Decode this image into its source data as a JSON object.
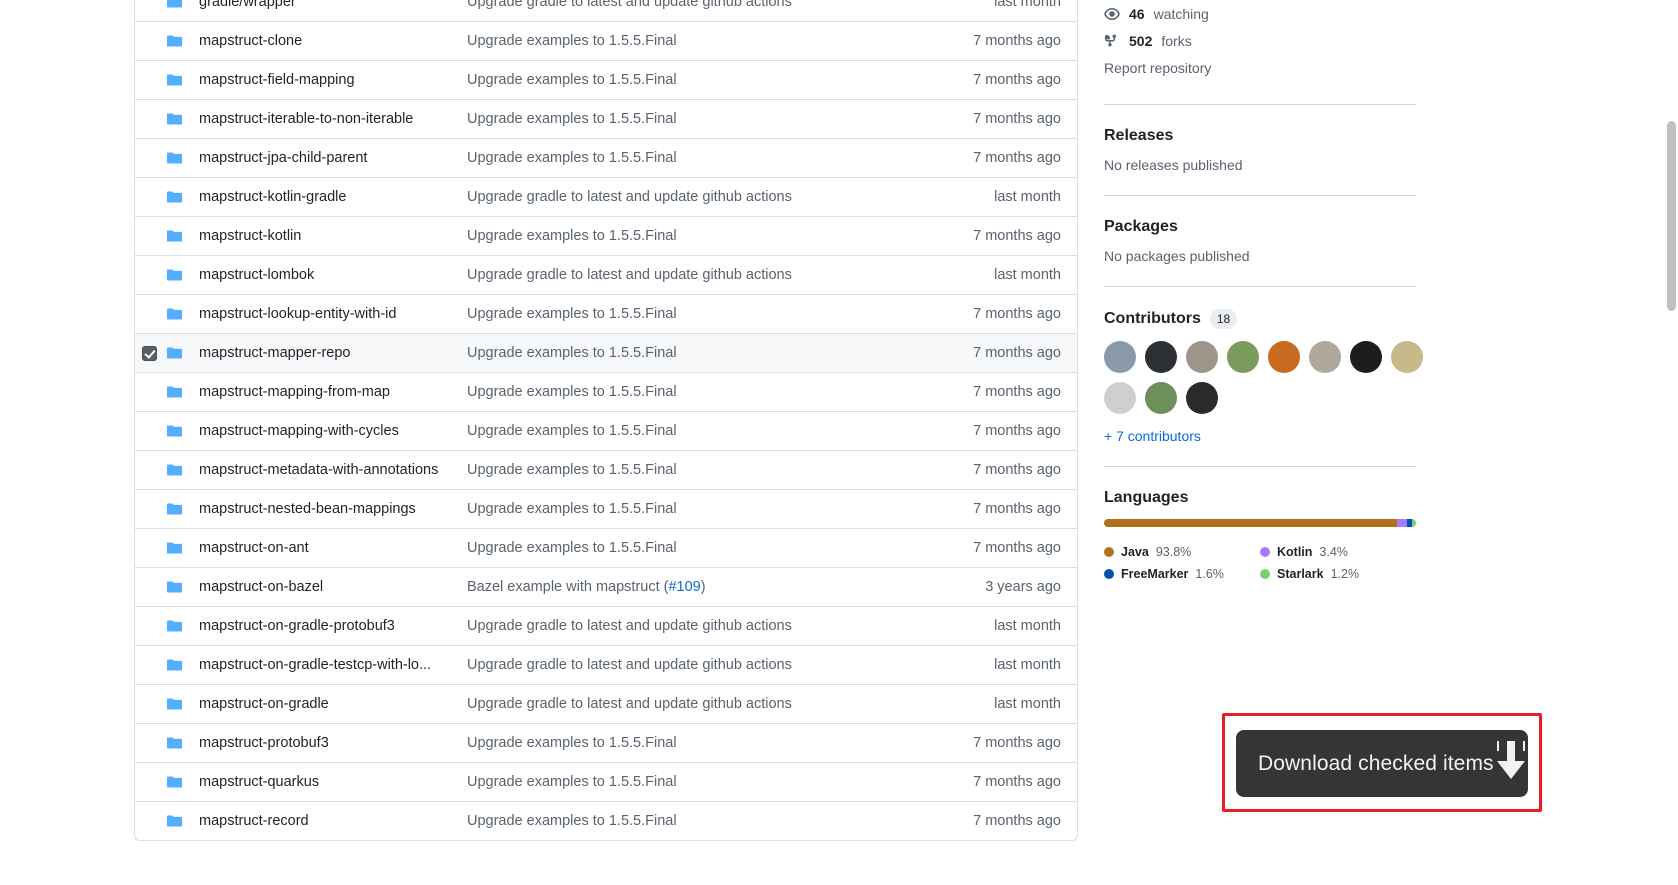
{
  "files": {
    "columns": [
      "checkbox",
      "icon",
      "name",
      "commit_message",
      "age"
    ],
    "rows": [
      {
        "checked": false,
        "icon": "folder-icon",
        "name": "gradle/wrapper",
        "message": "Upgrade gradle to latest and update github actions",
        "message_link": "",
        "age": "last month"
      },
      {
        "checked": false,
        "icon": "folder-icon",
        "name": "mapstruct-clone",
        "message": "Upgrade examples to 1.5.5.Final",
        "message_link": "",
        "age": "7 months ago"
      },
      {
        "checked": false,
        "icon": "folder-icon",
        "name": "mapstruct-field-mapping",
        "message": "Upgrade examples to 1.5.5.Final",
        "message_link": "",
        "age": "7 months ago"
      },
      {
        "checked": false,
        "icon": "folder-icon",
        "name": "mapstruct-iterable-to-non-iterable",
        "message": "Upgrade examples to 1.5.5.Final",
        "message_link": "",
        "age": "7 months ago"
      },
      {
        "checked": false,
        "icon": "folder-icon",
        "name": "mapstruct-jpa-child-parent",
        "message": "Upgrade examples to 1.5.5.Final",
        "message_link": "",
        "age": "7 months ago"
      },
      {
        "checked": false,
        "icon": "folder-icon",
        "name": "mapstruct-kotlin-gradle",
        "message": "Upgrade gradle to latest and update github actions",
        "message_link": "",
        "age": "last month"
      },
      {
        "checked": false,
        "icon": "folder-icon",
        "name": "mapstruct-kotlin",
        "message": "Upgrade examples to 1.5.5.Final",
        "message_link": "",
        "age": "7 months ago"
      },
      {
        "checked": false,
        "icon": "folder-icon",
        "name": "mapstruct-lombok",
        "message": "Upgrade gradle to latest and update github actions",
        "message_link": "",
        "age": "last month"
      },
      {
        "checked": false,
        "icon": "folder-icon",
        "name": "mapstruct-lookup-entity-with-id",
        "message": "Upgrade examples to 1.5.5.Final",
        "message_link": "",
        "age": "7 months ago"
      },
      {
        "checked": true,
        "icon": "folder-icon",
        "name": "mapstruct-mapper-repo",
        "message": "Upgrade examples to 1.5.5.Final",
        "message_link": "",
        "age": "7 months ago"
      },
      {
        "checked": false,
        "icon": "folder-icon",
        "name": "mapstruct-mapping-from-map",
        "message": "Upgrade examples to 1.5.5.Final",
        "message_link": "",
        "age": "7 months ago"
      },
      {
        "checked": false,
        "icon": "folder-icon",
        "name": "mapstruct-mapping-with-cycles",
        "message": "Upgrade examples to 1.5.5.Final",
        "message_link": "",
        "age": "7 months ago"
      },
      {
        "checked": false,
        "icon": "folder-icon",
        "name": "mapstruct-metadata-with-annotations",
        "message": "Upgrade examples to 1.5.5.Final",
        "message_link": "",
        "age": "7 months ago"
      },
      {
        "checked": false,
        "icon": "folder-icon",
        "name": "mapstruct-nested-bean-mappings",
        "message": "Upgrade examples to 1.5.5.Final",
        "message_link": "",
        "age": "7 months ago"
      },
      {
        "checked": false,
        "icon": "folder-icon",
        "name": "mapstruct-on-ant",
        "message": "Upgrade examples to 1.5.5.Final",
        "message_link": "",
        "age": "7 months ago"
      },
      {
        "checked": false,
        "icon": "folder-icon",
        "name": "mapstruct-on-bazel",
        "message": "Bazel example with mapstruct (",
        "message_link": "#109",
        "message_tail": ")",
        "age": "3 years ago"
      },
      {
        "checked": false,
        "icon": "folder-icon",
        "name": "mapstruct-on-gradle-protobuf3",
        "message": "Upgrade gradle to latest and update github actions",
        "message_link": "",
        "age": "last month"
      },
      {
        "checked": false,
        "icon": "folder-icon",
        "name": "mapstruct-on-gradle-testcp-with-lo...",
        "message": "Upgrade gradle to latest and update github actions",
        "message_link": "",
        "age": "last month"
      },
      {
        "checked": false,
        "icon": "folder-icon",
        "name": "mapstruct-on-gradle",
        "message": "Upgrade gradle to latest and update github actions",
        "message_link": "",
        "age": "last month"
      },
      {
        "checked": false,
        "icon": "folder-icon",
        "name": "mapstruct-protobuf3",
        "message": "Upgrade examples to 1.5.5.Final",
        "message_link": "",
        "age": "7 months ago"
      },
      {
        "checked": false,
        "icon": "folder-icon",
        "name": "mapstruct-quarkus",
        "message": "Upgrade examples to 1.5.5.Final",
        "message_link": "",
        "age": "7 months ago"
      },
      {
        "checked": false,
        "icon": "folder-icon",
        "name": "mapstruct-record",
        "message": "Upgrade examples to 1.5.5.Final",
        "message_link": "",
        "age": "7 months ago"
      }
    ]
  },
  "sidebar": {
    "watching": {
      "count": "46",
      "label": "watching",
      "icon": "eye-icon"
    },
    "forks": {
      "count": "502",
      "label": "forks",
      "icon": "fork-icon"
    },
    "report_repository": "Report repository",
    "releases": {
      "title": "Releases",
      "empty": "No releases published"
    },
    "packages": {
      "title": "Packages",
      "empty": "No packages published"
    },
    "contributors": {
      "title": "Contributors",
      "count": "18",
      "more_link": "+ 7 contributors",
      "avatars": [
        {
          "name": "avatar-1",
          "color": "#8a9aa8"
        },
        {
          "name": "avatar-2",
          "color": "#2c2f33"
        },
        {
          "name": "avatar-3",
          "color": "#9e958a"
        },
        {
          "name": "avatar-4",
          "color": "#7a9a5e"
        },
        {
          "name": "avatar-5",
          "color": "#c86a20"
        },
        {
          "name": "avatar-6",
          "color": "#b0a89a"
        },
        {
          "name": "avatar-7",
          "color": "#1d1d1f"
        },
        {
          "name": "avatar-8",
          "color": "#c7b98a"
        },
        {
          "name": "avatar-9",
          "color": "#cfcfcf"
        },
        {
          "name": "avatar-10",
          "color": "#6f8f5a"
        },
        {
          "name": "avatar-11",
          "color": "#2a2a2a"
        }
      ]
    },
    "languages": {
      "title": "Languages",
      "items": [
        {
          "name": "Java",
          "percent": "93.8%",
          "value": 93.8,
          "color": "#b07219"
        },
        {
          "name": "Kotlin",
          "percent": "3.4%",
          "value": 3.4,
          "color": "#a97bff"
        },
        {
          "name": "FreeMarker",
          "percent": "1.6%",
          "value": 1.6,
          "color": "#0050b2"
        },
        {
          "name": "Starlark",
          "percent": "1.2%",
          "value": 1.2,
          "color": "#76d275"
        }
      ]
    }
  },
  "download_overlay": {
    "label": "Download checked items",
    "icon": "download-arrow-icon",
    "button_bg": "#353535",
    "outline_color": "#ec1c24"
  },
  "colors": {
    "link": "#0969da",
    "folder": "#54aeff",
    "text": "#1f2328",
    "muted": "#59636e",
    "border": "#d8dee4",
    "row_selected_bg": "#f6f8fa"
  }
}
